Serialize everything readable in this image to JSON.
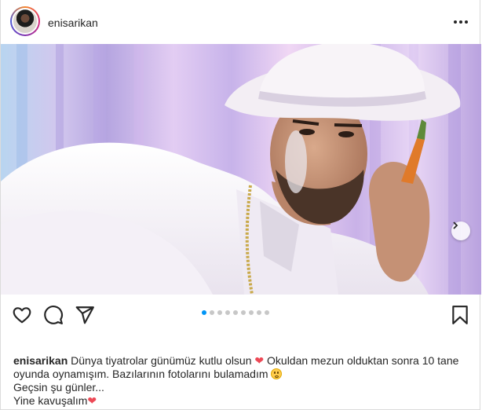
{
  "post": {
    "username": "enisarikan",
    "more_icon": "more-horizontal-icon",
    "image": {
      "next_icon": "chevron-right-icon",
      "carousel_count": 9,
      "carousel_active": 0
    },
    "actions": {
      "like_icon": "heart-icon",
      "comment_icon": "comment-icon",
      "share_icon": "send-icon",
      "save_icon": "bookmark-icon"
    },
    "caption": {
      "username": "enisarikan",
      "line1_a": "Dünya tiyatrolar günümüz kutlu olsun",
      "line1_heart": "❤",
      "line1_b": "Okuldan mezun olduktan sonra 10 tane",
      "line2": "oyunda oynamışım. Bazılarının fotolarını bulamadım",
      "line3": "Geçsin şu günler...",
      "line4": "Yine kavuşalım",
      "line4_heart": "❤"
    }
  }
}
